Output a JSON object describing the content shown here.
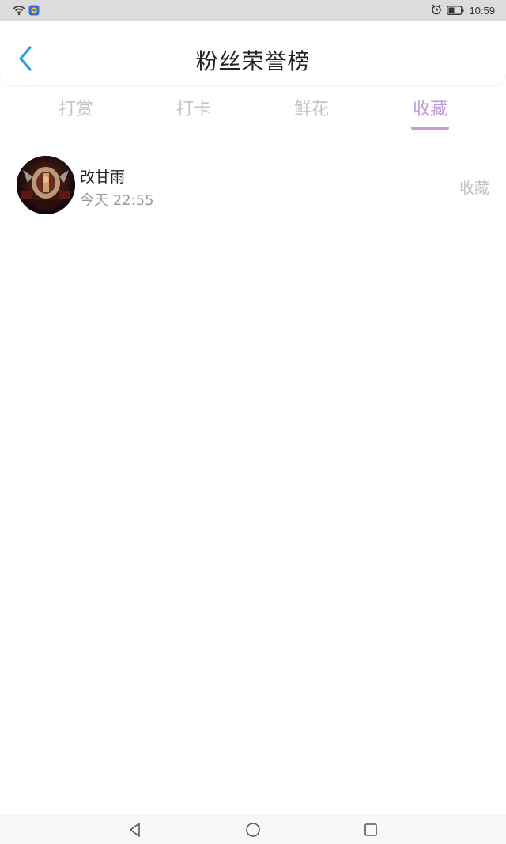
{
  "status_bar": {
    "time": "10:59",
    "icons": [
      "wifi-icon",
      "app-notification-icon",
      "alarm-icon",
      "battery-icon"
    ]
  },
  "header": {
    "title": "粉丝荣誉榜",
    "back_icon": "chevron-left-icon"
  },
  "tabs": [
    {
      "label": "打赏",
      "active": false
    },
    {
      "label": "打卡",
      "active": false
    },
    {
      "label": "鲜花",
      "active": false
    },
    {
      "label": "收藏",
      "active": true
    }
  ],
  "list": [
    {
      "name": "改甘雨",
      "time": "今天 22:55",
      "action": "收藏",
      "avatar_icon": "avatar-image"
    }
  ],
  "colors": {
    "accent": "#c29bd9",
    "back_arrow": "#2a9fe0",
    "tab_inactive": "#c4c4c4"
  },
  "nav_bar": {
    "buttons": [
      "back-triangle-icon",
      "home-circle-icon",
      "recents-square-icon"
    ]
  }
}
